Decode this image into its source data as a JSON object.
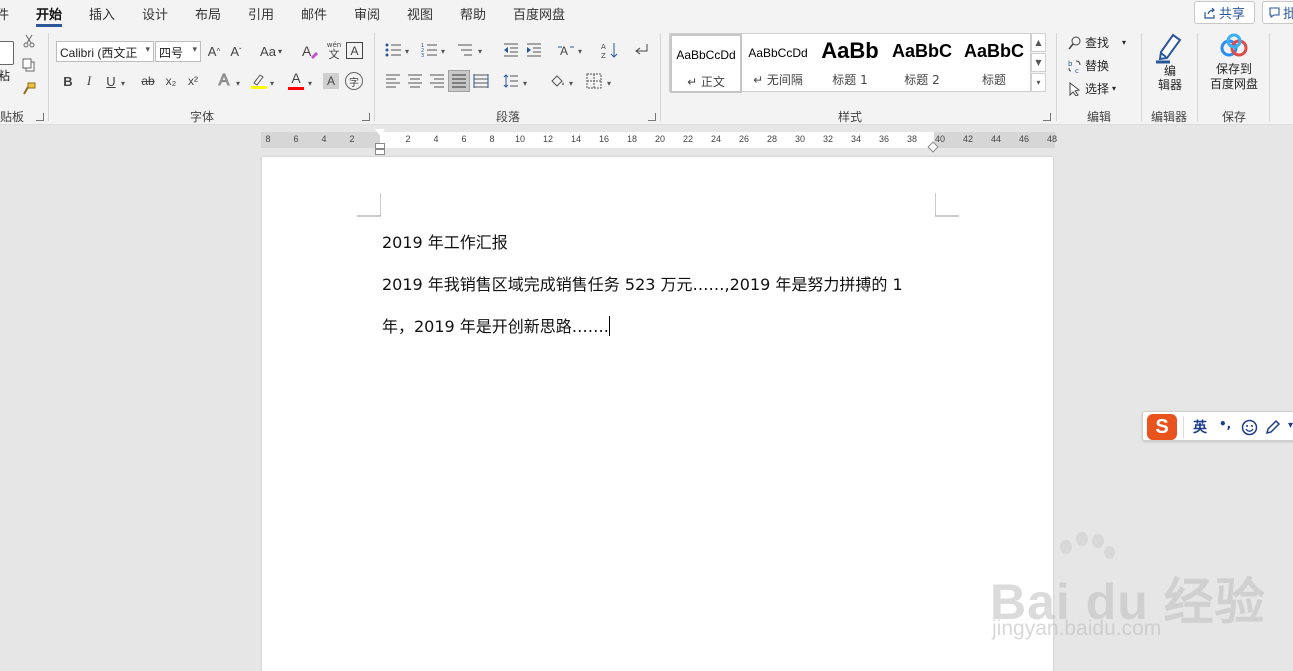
{
  "tabs": [
    {
      "label": "件",
      "active": false
    },
    {
      "label": "开始",
      "active": true
    },
    {
      "label": "插入",
      "active": false
    },
    {
      "label": "设计",
      "active": false
    },
    {
      "label": "布局",
      "active": false
    },
    {
      "label": "引用",
      "active": false
    },
    {
      "label": "邮件",
      "active": false
    },
    {
      "label": "审阅",
      "active": false
    },
    {
      "label": "视图",
      "active": false
    },
    {
      "label": "帮助",
      "active": false
    },
    {
      "label": "百度网盘",
      "active": false
    }
  ],
  "share_label": "共享",
  "comment_label": "批",
  "clipboard": {
    "paste_label": "粘",
    "group_label": "贴板"
  },
  "font": {
    "font_name": "Calibri (西文正",
    "font_size": "四号",
    "grow_icon": "A^",
    "shrink_icon": "Aˇ",
    "case_label": "Aa",
    "phonetic_top": "wén",
    "phonetic_bottom": "文",
    "bold": "B",
    "italic": "I",
    "underline": "U",
    "strike": "ab",
    "subscript": "x₂",
    "superscript": "x²",
    "effects": "A",
    "highlight": "ab",
    "font_color": "A",
    "shading": "A",
    "enclose": "字",
    "group_label": "字体"
  },
  "paragraph": {
    "group_label": "段落"
  },
  "styles": {
    "items": [
      {
        "sample": "AaBbCcDd",
        "name": "↵ 正文",
        "selected": true
      },
      {
        "sample": "AaBbCcDd",
        "name": "↵ 无间隔",
        "selected": false
      },
      {
        "sample": "AaBb",
        "name": "标题 1",
        "selected": false
      },
      {
        "sample": "AaBbC",
        "name": "标题 2",
        "selected": false
      },
      {
        "sample": "AaBbC",
        "name": "标题",
        "selected": false
      }
    ],
    "group_label": "样式"
  },
  "editing": {
    "find": "查找",
    "replace": "替换",
    "select": "选择",
    "group_label": "编辑"
  },
  "editor": {
    "label_line1": "编",
    "label_line2": "辑器",
    "group_label": "编辑器"
  },
  "save": {
    "label_line1": "保存到",
    "label_line2": "百度网盘",
    "group_label": "保存"
  },
  "ruler_ticks": [
    "8",
    "6",
    "4",
    "2",
    "",
    "2",
    "4",
    "6",
    "8",
    "10",
    "12",
    "14",
    "16",
    "18",
    "20",
    "22",
    "24",
    "26",
    "28",
    "30",
    "32",
    "34",
    "36",
    "38",
    "40",
    "42",
    "44",
    "46",
    "48"
  ],
  "document": {
    "lines": [
      "2019 年工作汇报",
      "2019 年我销售区域完成销售任务 523 万元……,2019 年是努力拼搏的 1",
      "年，2019 年是开创新思路……."
    ]
  },
  "ime": {
    "logo": "S",
    "lang": "英",
    "punct": "•,"
  },
  "watermark": {
    "brand": "Bai  du 经验",
    "url": "jingyan.baidu.com"
  },
  "colors": {
    "accent": "#2b579a",
    "highlight": "#ffff00",
    "font_color": "#ff0000",
    "ime": "#e8531e"
  }
}
